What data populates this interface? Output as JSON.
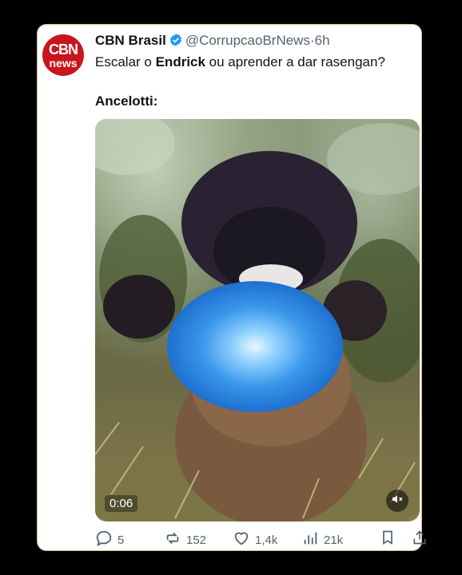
{
  "tweet": {
    "avatar_line1": "CBN",
    "avatar_line2": "news",
    "author_name": "CBN Brasil",
    "handle": "@CorrupcaoBrNews",
    "separator": "·",
    "time": "6h",
    "text_part1": "Escalar o ",
    "text_bold": "Endrick",
    "text_part2": " ou aprender a dar rasengan?",
    "text_line2": "Ancelotti:"
  },
  "media": {
    "duration": "0:06"
  },
  "actions": {
    "replies": "5",
    "reposts": "152",
    "likes": "1,4k",
    "views": "21k"
  },
  "colors": {
    "brand_red": "#c8161d",
    "verified_blue": "#1d9bf0",
    "muted_text": "#536471",
    "rasengan_blue": "#3aa0f0"
  }
}
